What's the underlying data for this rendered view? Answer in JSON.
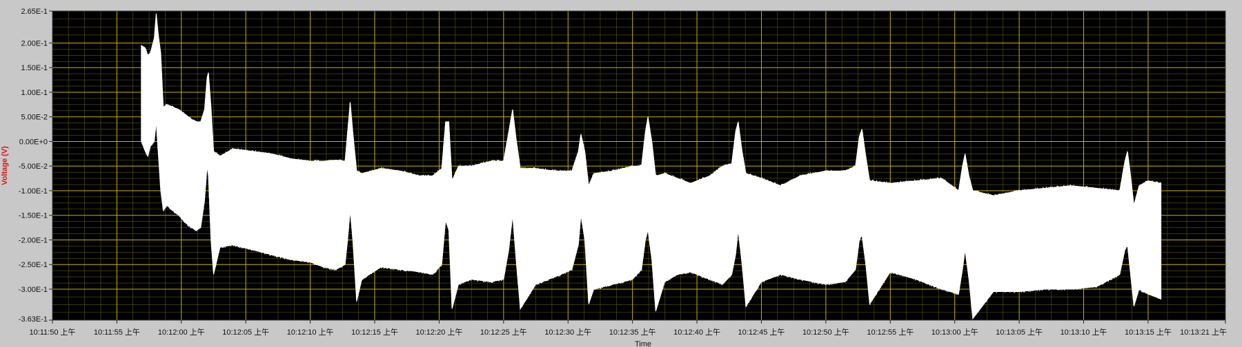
{
  "chart_data": {
    "type": "area",
    "title": "",
    "xlabel": "Time",
    "ylabel": "Voltage (V)",
    "ylim": [
      -0.363,
      0.265
    ],
    "grid": true,
    "background_color": "#000000",
    "grid_major_color": "#c8b400",
    "grid_minor_color": "#5a5a14",
    "trace_color": "#ffffff",
    "y_ticks": [
      {
        "value": 0.265,
        "label": "2.65E-1"
      },
      {
        "value": 0.2,
        "label": "2.00E-1"
      },
      {
        "value": 0.15,
        "label": "1.50E-1"
      },
      {
        "value": 0.1,
        "label": "1.00E-1"
      },
      {
        "value": 0.05,
        "label": "5.00E-2"
      },
      {
        "value": 0.0,
        "label": "0.00E+0"
      },
      {
        "value": -0.05,
        "label": "-5.00E-2"
      },
      {
        "value": -0.1,
        "label": "-1.00E-1"
      },
      {
        "value": -0.15,
        "label": "-1.50E-1"
      },
      {
        "value": -0.2,
        "label": "-2.00E-1"
      },
      {
        "value": -0.25,
        "label": "-2.50E-1"
      },
      {
        "value": -0.3,
        "label": "-3.00E-1"
      },
      {
        "value": -0.363,
        "label": "-3.63E-1"
      }
    ],
    "x_range_seconds": [
      0,
      91
    ],
    "x_ticks": [
      {
        "value": 0,
        "label": "10:11:50 上午"
      },
      {
        "value": 5,
        "label": "10:11:55 上午"
      },
      {
        "value": 10,
        "label": "10:12:00 上午"
      },
      {
        "value": 15,
        "label": "10:12:05 上午"
      },
      {
        "value": 20,
        "label": "10:12:10 上午"
      },
      {
        "value": 25,
        "label": "10:12:15 上午"
      },
      {
        "value": 30,
        "label": "10:12:20 上午"
      },
      {
        "value": 35,
        "label": "10:12:25 上午"
      },
      {
        "value": 40,
        "label": "10:12:30 上午"
      },
      {
        "value": 45,
        "label": "10:12:35 上午"
      },
      {
        "value": 50,
        "label": "10:12:40 上午"
      },
      {
        "value": 55,
        "label": "10:12:45 上午"
      },
      {
        "value": 60,
        "label": "10:12:50 上午"
      },
      {
        "value": 65,
        "label": "10:12:55 上午"
      },
      {
        "value": 70,
        "label": "10:13:00 上午"
      },
      {
        "value": 75,
        "label": "10:13:05 上午"
      },
      {
        "value": 80,
        "label": "10:13:10 上午"
      },
      {
        "value": 85,
        "label": "10:13:15 上午"
      },
      {
        "value": 91,
        "label": "10:13:21 上午"
      }
    ],
    "series": [
      {
        "envelope_upper": [
          [
            6.9,
            0.195
          ],
          [
            7.2,
            0.19
          ],
          [
            7.4,
            0.175
          ],
          [
            7.6,
            0.18
          ],
          [
            7.9,
            0.21
          ],
          [
            8.05,
            0.26
          ],
          [
            8.2,
            0.22
          ],
          [
            8.4,
            0.18
          ],
          [
            8.6,
            0.07
          ],
          [
            8.9,
            0.075
          ],
          [
            9.3,
            0.07
          ],
          [
            9.8,
            0.065
          ],
          [
            10.3,
            0.055
          ],
          [
            10.8,
            0.045
          ],
          [
            11.2,
            0.04
          ],
          [
            11.5,
            0.04
          ],
          [
            11.8,
            0.065
          ],
          [
            12.0,
            0.13
          ],
          [
            12.1,
            0.14
          ],
          [
            12.3,
            0.07
          ],
          [
            12.5,
            -0.02
          ],
          [
            13.0,
            -0.03
          ],
          [
            14.0,
            -0.015
          ],
          [
            15.5,
            -0.02
          ],
          [
            17.0,
            -0.025
          ],
          [
            18.5,
            -0.035
          ],
          [
            20.0,
            -0.04
          ],
          [
            21.0,
            -0.04
          ],
          [
            22.0,
            -0.038
          ],
          [
            22.7,
            -0.04
          ],
          [
            22.9,
            0.02
          ],
          [
            23.1,
            0.08
          ],
          [
            23.3,
            0.02
          ],
          [
            23.6,
            -0.06
          ],
          [
            24.0,
            -0.065
          ],
          [
            25.5,
            -0.055
          ],
          [
            27.0,
            -0.06
          ],
          [
            28.5,
            -0.07
          ],
          [
            29.5,
            -0.07
          ],
          [
            30.2,
            -0.055
          ],
          [
            30.5,
            0.04
          ],
          [
            30.75,
            0.04
          ],
          [
            31.0,
            -0.08
          ],
          [
            31.5,
            -0.05
          ],
          [
            32.5,
            -0.05
          ],
          [
            34.0,
            -0.04
          ],
          [
            35.0,
            -0.04
          ],
          [
            35.4,
            0.02
          ],
          [
            35.7,
            0.065
          ],
          [
            36.0,
            0.0
          ],
          [
            36.3,
            -0.055
          ],
          [
            37.5,
            -0.055
          ],
          [
            39.0,
            -0.06
          ],
          [
            40.3,
            -0.06
          ],
          [
            40.8,
            -0.02
          ],
          [
            41.0,
            0.015
          ],
          [
            41.3,
            -0.02
          ],
          [
            41.6,
            -0.09
          ],
          [
            42.0,
            -0.065
          ],
          [
            43.5,
            -0.06
          ],
          [
            45.0,
            -0.05
          ],
          [
            45.7,
            -0.05
          ],
          [
            46.0,
            0.02
          ],
          [
            46.2,
            0.05
          ],
          [
            46.5,
            0.0
          ],
          [
            46.8,
            -0.07
          ],
          [
            47.5,
            -0.065
          ],
          [
            48.5,
            -0.075
          ],
          [
            49.5,
            -0.085
          ],
          [
            51.0,
            -0.07
          ],
          [
            52.0,
            -0.05
          ],
          [
            52.7,
            -0.045
          ],
          [
            53.0,
            0.02
          ],
          [
            53.2,
            0.04
          ],
          [
            53.5,
            -0.02
          ],
          [
            53.8,
            -0.065
          ],
          [
            55.0,
            -0.075
          ],
          [
            56.5,
            -0.09
          ],
          [
            58.0,
            -0.07
          ],
          [
            60.0,
            -0.06
          ],
          [
            61.5,
            -0.06
          ],
          [
            62.3,
            -0.05
          ],
          [
            62.6,
            0.01
          ],
          [
            62.8,
            0.025
          ],
          [
            63.1,
            -0.03
          ],
          [
            63.4,
            -0.08
          ],
          [
            65.0,
            -0.085
          ],
          [
            67.0,
            -0.08
          ],
          [
            69.0,
            -0.075
          ],
          [
            70.3,
            -0.1
          ],
          [
            70.6,
            -0.05
          ],
          [
            70.8,
            -0.025
          ],
          [
            71.1,
            -0.07
          ],
          [
            71.4,
            -0.1
          ],
          [
            73.0,
            -0.11
          ],
          [
            75.0,
            -0.1
          ],
          [
            77.0,
            -0.095
          ],
          [
            79.0,
            -0.09
          ],
          [
            81.0,
            -0.095
          ],
          [
            82.8,
            -0.1
          ],
          [
            83.2,
            -0.04
          ],
          [
            83.4,
            -0.02
          ],
          [
            83.6,
            -0.06
          ],
          [
            83.9,
            -0.13
          ],
          [
            84.3,
            -0.09
          ],
          [
            85.0,
            -0.08
          ],
          [
            86.0,
            -0.085
          ]
        ],
        "envelope_lower": [
          [
            6.9,
            0.0
          ],
          [
            7.2,
            -0.02
          ],
          [
            7.4,
            -0.03
          ],
          [
            7.6,
            -0.01
          ],
          [
            7.9,
            0.0
          ],
          [
            8.05,
            0.04
          ],
          [
            8.2,
            -0.02
          ],
          [
            8.4,
            -0.1
          ],
          [
            8.6,
            -0.14
          ],
          [
            8.9,
            -0.13
          ],
          [
            9.3,
            -0.14
          ],
          [
            9.8,
            -0.15
          ],
          [
            10.3,
            -0.165
          ],
          [
            10.8,
            -0.175
          ],
          [
            11.2,
            -0.18
          ],
          [
            11.5,
            -0.175
          ],
          [
            11.8,
            -0.12
          ],
          [
            12.0,
            -0.05
          ],
          [
            12.1,
            -0.07
          ],
          [
            12.3,
            -0.2
          ],
          [
            12.5,
            -0.27
          ],
          [
            13.0,
            -0.215
          ],
          [
            14.0,
            -0.21
          ],
          [
            15.5,
            -0.22
          ],
          [
            17.0,
            -0.23
          ],
          [
            18.5,
            -0.24
          ],
          [
            20.0,
            -0.245
          ],
          [
            21.0,
            -0.255
          ],
          [
            22.0,
            -0.26
          ],
          [
            22.7,
            -0.25
          ],
          [
            22.9,
            -0.2
          ],
          [
            23.1,
            -0.14
          ],
          [
            23.3,
            -0.2
          ],
          [
            23.6,
            -0.325
          ],
          [
            24.0,
            -0.28
          ],
          [
            25.5,
            -0.255
          ],
          [
            27.0,
            -0.26
          ],
          [
            28.5,
            -0.265
          ],
          [
            29.5,
            -0.27
          ],
          [
            30.2,
            -0.25
          ],
          [
            30.5,
            -0.16
          ],
          [
            30.75,
            -0.18
          ],
          [
            31.0,
            -0.34
          ],
          [
            31.5,
            -0.29
          ],
          [
            32.5,
            -0.28
          ],
          [
            34.0,
            -0.285
          ],
          [
            35.0,
            -0.28
          ],
          [
            35.4,
            -0.22
          ],
          [
            35.7,
            -0.15
          ],
          [
            36.0,
            -0.25
          ],
          [
            36.3,
            -0.34
          ],
          [
            37.5,
            -0.29
          ],
          [
            39.0,
            -0.275
          ],
          [
            40.3,
            -0.26
          ],
          [
            40.8,
            -0.21
          ],
          [
            41.0,
            -0.15
          ],
          [
            41.3,
            -0.2
          ],
          [
            41.6,
            -0.33
          ],
          [
            42.0,
            -0.3
          ],
          [
            43.5,
            -0.29
          ],
          [
            45.0,
            -0.28
          ],
          [
            45.7,
            -0.26
          ],
          [
            46.0,
            -0.2
          ],
          [
            46.2,
            -0.18
          ],
          [
            46.5,
            -0.24
          ],
          [
            46.8,
            -0.345
          ],
          [
            47.5,
            -0.285
          ],
          [
            48.5,
            -0.27
          ],
          [
            49.5,
            -0.265
          ],
          [
            51.0,
            -0.28
          ],
          [
            52.0,
            -0.29
          ],
          [
            52.7,
            -0.27
          ],
          [
            53.0,
            -0.23
          ],
          [
            53.2,
            -0.18
          ],
          [
            53.5,
            -0.25
          ],
          [
            53.8,
            -0.335
          ],
          [
            55.0,
            -0.285
          ],
          [
            56.5,
            -0.27
          ],
          [
            58.0,
            -0.28
          ],
          [
            60.0,
            -0.29
          ],
          [
            61.5,
            -0.285
          ],
          [
            62.3,
            -0.26
          ],
          [
            62.6,
            -0.2
          ],
          [
            62.8,
            -0.19
          ],
          [
            63.1,
            -0.25
          ],
          [
            63.4,
            -0.33
          ],
          [
            65.0,
            -0.265
          ],
          [
            67.0,
            -0.28
          ],
          [
            69.0,
            -0.3
          ],
          [
            70.3,
            -0.31
          ],
          [
            70.6,
            -0.26
          ],
          [
            70.8,
            -0.22
          ],
          [
            71.1,
            -0.28
          ],
          [
            71.4,
            -0.36
          ],
          [
            73.0,
            -0.305
          ],
          [
            75.0,
            -0.305
          ],
          [
            77.0,
            -0.3
          ],
          [
            79.0,
            -0.3
          ],
          [
            81.0,
            -0.295
          ],
          [
            82.8,
            -0.27
          ],
          [
            83.2,
            -0.22
          ],
          [
            83.4,
            -0.21
          ],
          [
            83.6,
            -0.26
          ],
          [
            83.9,
            -0.335
          ],
          [
            84.3,
            -0.3
          ],
          [
            85.0,
            -0.31
          ],
          [
            86.0,
            -0.32
          ]
        ]
      }
    ]
  }
}
